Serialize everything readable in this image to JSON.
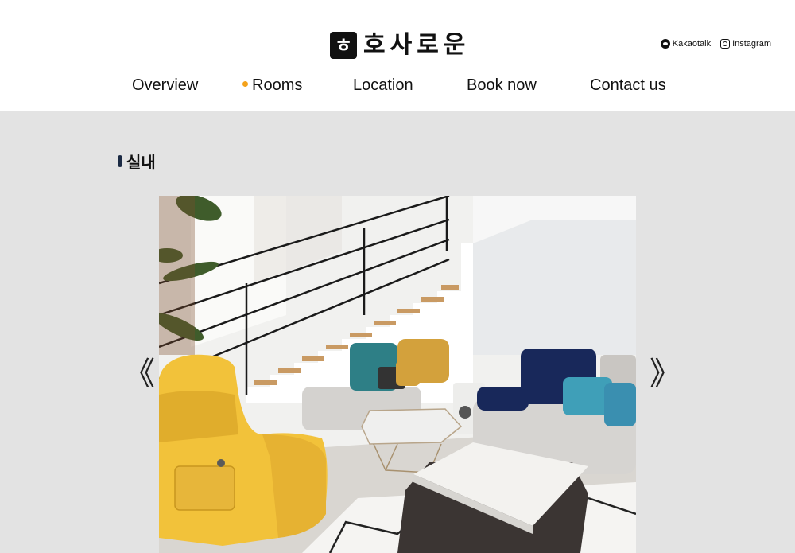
{
  "brand": {
    "mark": "ㅎ",
    "name": "호사로운"
  },
  "social": [
    {
      "label": "Kakaotalk",
      "icon": "kakaotalk-icon"
    },
    {
      "label": "Instagram",
      "icon": "instagram-icon"
    }
  ],
  "nav": {
    "items": [
      {
        "label": "Overview",
        "active": false
      },
      {
        "label": "Rooms",
        "active": true
      },
      {
        "label": "Location",
        "active": false
      },
      {
        "label": "Book now",
        "active": false
      },
      {
        "label": "Contact us",
        "active": false
      }
    ],
    "active_color": "#f4a21b"
  },
  "section": {
    "title": "실내"
  },
  "carousel": {
    "prev_glyph": "《",
    "next_glyph": "》",
    "image_subject": "living-room-interior"
  },
  "colors": {
    "header_bg": "#ffffff",
    "content_bg": "#e3e3e3",
    "accent": "#f4a21b",
    "title_bar": "#1b2a44"
  }
}
